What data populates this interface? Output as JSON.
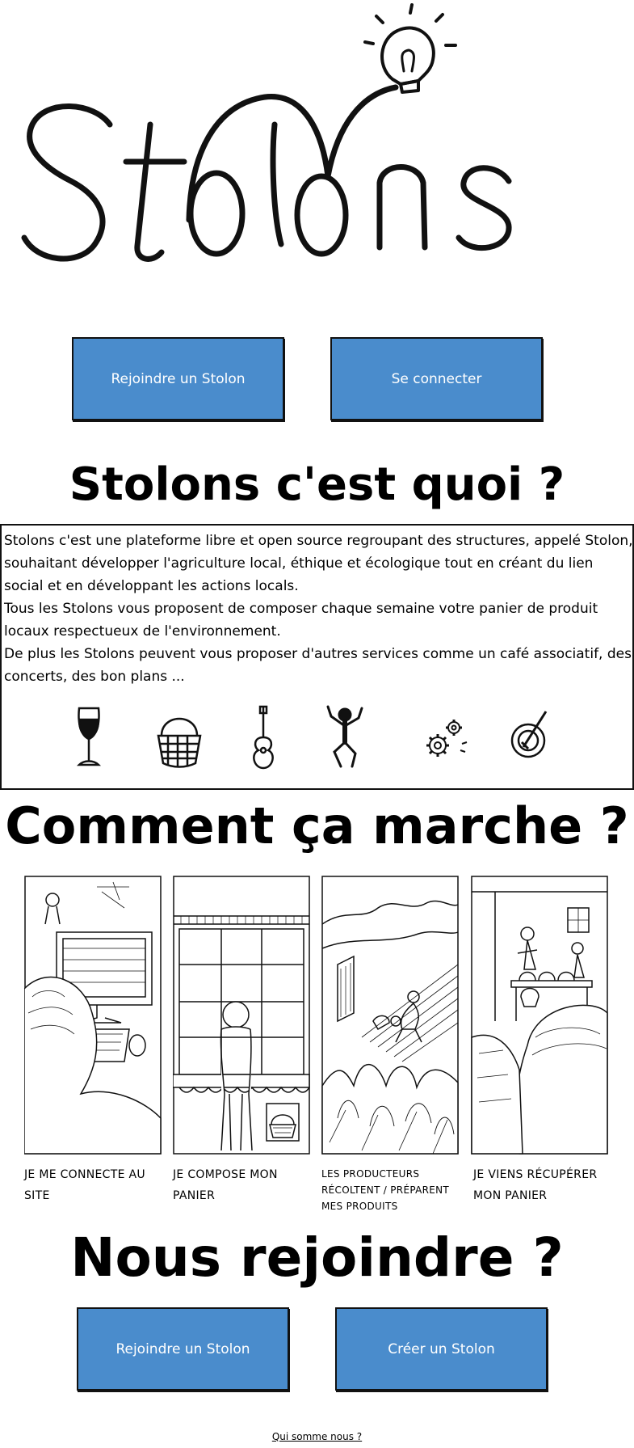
{
  "logo": {
    "text": "Stolons"
  },
  "top_buttons": {
    "join_label": "Rejoindre un Stolon",
    "login_label": "Se connecter"
  },
  "about": {
    "heading": "Stolons c'est quoi ?",
    "paragraphs": [
      "Stolons c'est une plateforme libre et open source regroupant des structures, appelé Stolon, souhaitant développer l'agriculture local, éthique et écologique tout en créant du lien social et en développant les actions locals.",
      "Tous les Stolons vous proposent de composer chaque semaine votre panier de produit locaux respectueux de l'environnement.",
      "De plus les Stolons peuvent vous proposer d'autres services comme un café associatif, des concerts, des bon plans ..."
    ],
    "icons": [
      "wine-glass-icon",
      "basket-icon",
      "guitar-icon",
      "dancer-icon",
      "gears-icon",
      "plate-icon"
    ]
  },
  "how": {
    "heading": "Comment ça marche ?",
    "steps": [
      "JE ME CONNECTE AU SITE",
      "JE COMPOSE MON PANIER",
      "LES PRODUCTEURS RÉCOLTENT / PRÉPARENT MES PRODUITS",
      "JE VIENS RÉCUPÉRER MON PANIER"
    ]
  },
  "join": {
    "heading": "Nous rejoindre ?",
    "join_label": "Rejoindre un Stolon",
    "create_label": "Créer un Stolon"
  },
  "footer": {
    "about_link": "Qui somme nous ?"
  },
  "colors": {
    "button_bg": "#4a8ccc",
    "button_text": "#ffffff",
    "ink": "#000000"
  }
}
